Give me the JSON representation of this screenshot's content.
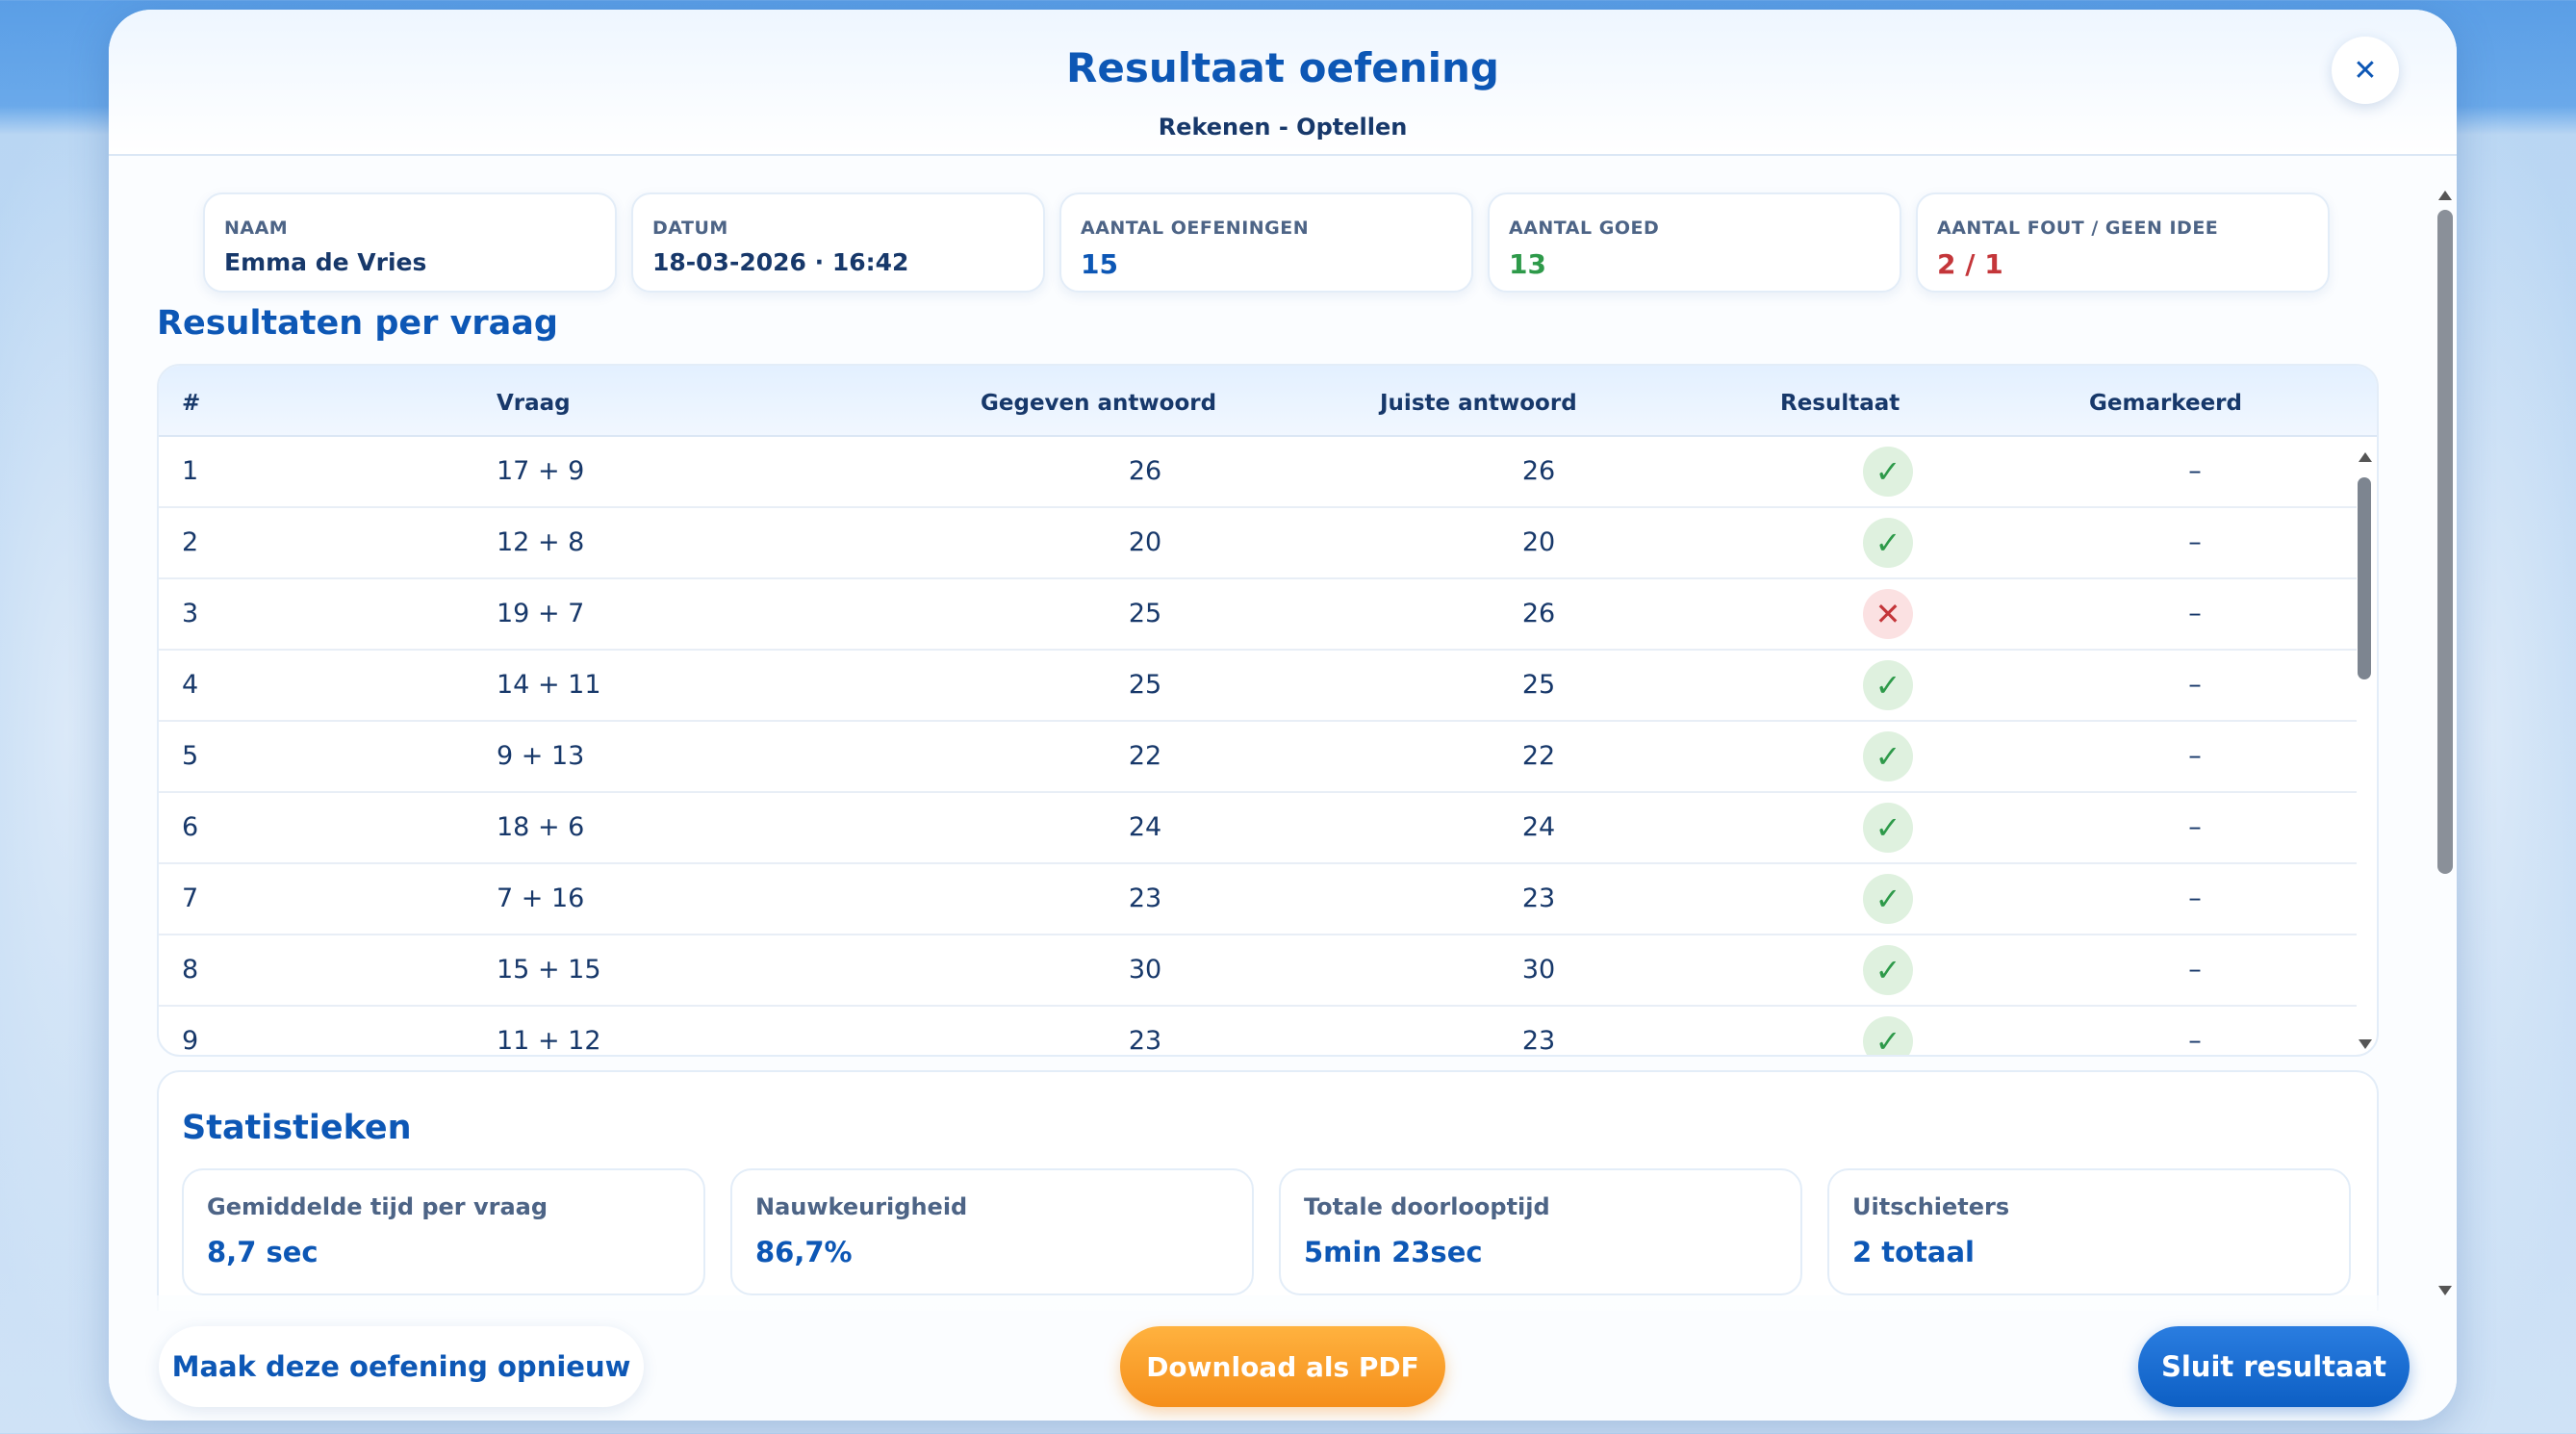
{
  "header": {
    "title": "Resultaat oefening",
    "subtitle": "Rekenen - Optellen",
    "close_symbol": "✕"
  },
  "info": {
    "name_label": "NAAM",
    "name_value": "Emma de Vries",
    "date_label": "DATUM",
    "date_value": "18-03-2026 · 16:42",
    "count_label": "AANTAL OEFENINGEN",
    "count_value": "15",
    "correct_label": "AANTAL GOED",
    "correct_value": "13",
    "wrong_label": "AANTAL FOUT / GEEN IDEE",
    "wrong_value": "2 / 1"
  },
  "results": {
    "title": "Resultaten per vraag",
    "headers": [
      "#",
      "Vraag",
      "Gegeven antwoord",
      "Juiste antwoord",
      "Resultaat",
      "Gemarkeerd"
    ],
    "rows": [
      {
        "n": "1",
        "q": "17 + 9",
        "given": "26",
        "correct": "26",
        "ok": true,
        "marked": "–"
      },
      {
        "n": "2",
        "q": "12 + 8",
        "given": "20",
        "correct": "20",
        "ok": true,
        "marked": "–"
      },
      {
        "n": "3",
        "q": "19 + 7",
        "given": "25",
        "correct": "26",
        "ok": false,
        "marked": "–"
      },
      {
        "n": "4",
        "q": "14 + 11",
        "given": "25",
        "correct": "25",
        "ok": true,
        "marked": "–"
      },
      {
        "n": "5",
        "q": "9 + 13",
        "given": "22",
        "correct": "22",
        "ok": true,
        "marked": "–"
      },
      {
        "n": "6",
        "q": "18 + 6",
        "given": "24",
        "correct": "24",
        "ok": true,
        "marked": "–"
      },
      {
        "n": "7",
        "q": "7 + 16",
        "given": "23",
        "correct": "23",
        "ok": true,
        "marked": "–"
      },
      {
        "n": "8",
        "q": "15 + 15",
        "given": "30",
        "correct": "30",
        "ok": true,
        "marked": "–"
      },
      {
        "n": "9",
        "q": "11 + 12",
        "given": "23",
        "correct": "23",
        "ok": true,
        "marked": "–"
      }
    ]
  },
  "stats": {
    "title": "Statistieken",
    "cards": [
      {
        "label": "Gemiddelde tijd per vraag",
        "value": "8,7 sec"
      },
      {
        "label": "Nauwkeurigheid",
        "value": "86,7%"
      },
      {
        "label": "Totale doorlooptijd",
        "value": "5min 23sec"
      },
      {
        "label": "Uitschieters",
        "value": "2 totaal"
      }
    ]
  },
  "footer": {
    "redo_label": "Maak deze oefening opnieuw",
    "pdf_label": "Download als PDF",
    "close_label": "Sluit resultaat"
  },
  "colors": {
    "accent": "#0d57b5",
    "correct": "#2e9a4a",
    "wrong": "#c4363a",
    "pdf_button": "#f58f1b"
  },
  "icons": {
    "ok": "✓",
    "bad": "✕"
  }
}
